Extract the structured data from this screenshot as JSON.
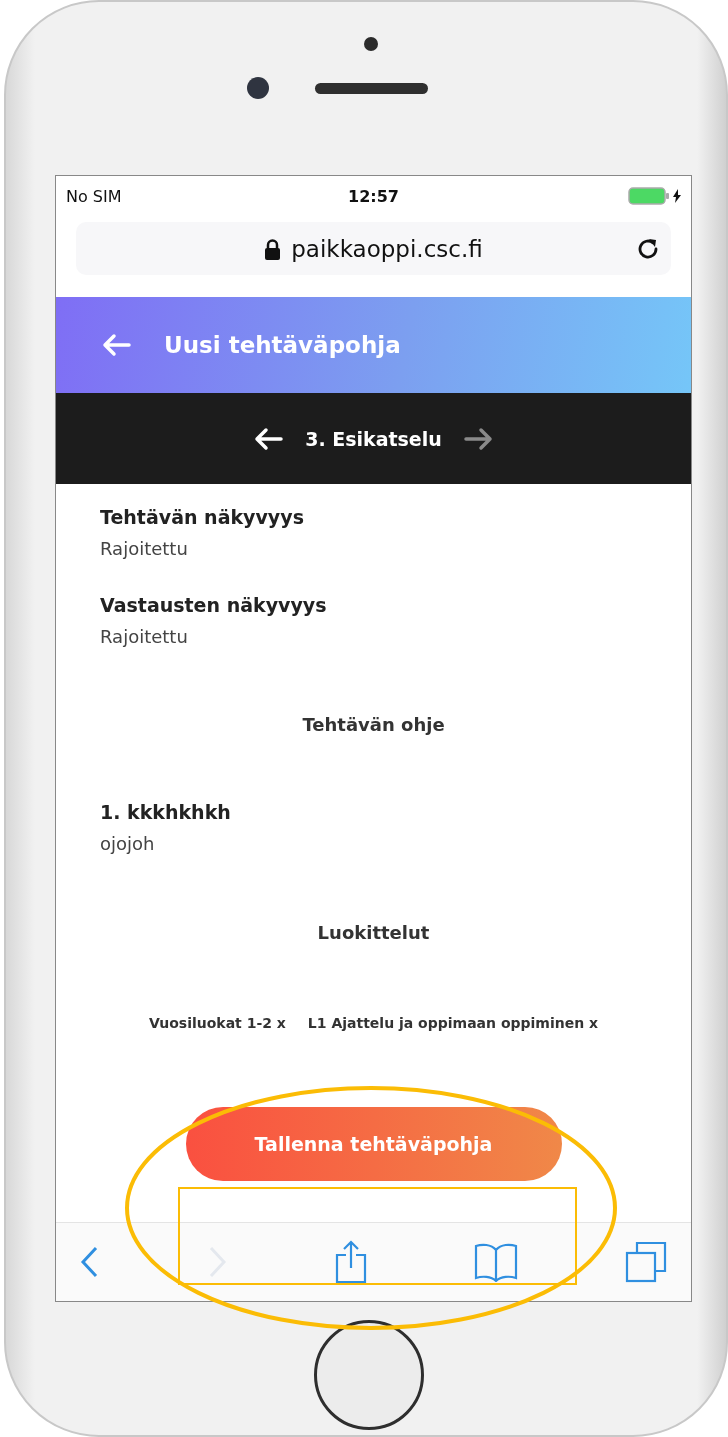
{
  "status_bar": {
    "carrier": "No SIM",
    "time": "12:57",
    "charging": true
  },
  "browser": {
    "url": "paikkaoppi.csc.fi"
  },
  "header": {
    "title": "Uusi tehtäväpohja"
  },
  "stepper": {
    "step": "3. Esikatselu",
    "prev_disabled": false,
    "next_disabled": true
  },
  "fields": [
    {
      "label": "Tehtävän näkyvyys",
      "value": "Rajoitettu"
    },
    {
      "label": "Vastausten näkyvyys",
      "value": "Rajoitettu"
    }
  ],
  "instructions": {
    "heading": "Tehtävän ohje",
    "tasks": [
      {
        "title": "1. kkkhkhkh",
        "text": "ojojoh"
      }
    ]
  },
  "classifications": {
    "heading": "Luokittelut",
    "tags": [
      "Vuosiluokat 1-2 x",
      "L1 Ajattelu ja oppimaan oppiminen x"
    ]
  },
  "save_button": "Tallenna tehtäväpohja",
  "toolbar": [
    {
      "kind": "back",
      "disabled": false
    },
    {
      "kind": "forward",
      "disabled": true
    },
    {
      "kind": "share",
      "disabled": false
    },
    {
      "kind": "bookmarks",
      "disabled": false
    },
    {
      "kind": "tabs",
      "disabled": false
    }
  ],
  "annotations": [
    {
      "kind": "ellipse"
    },
    {
      "kind": "rectangle"
    }
  ]
}
